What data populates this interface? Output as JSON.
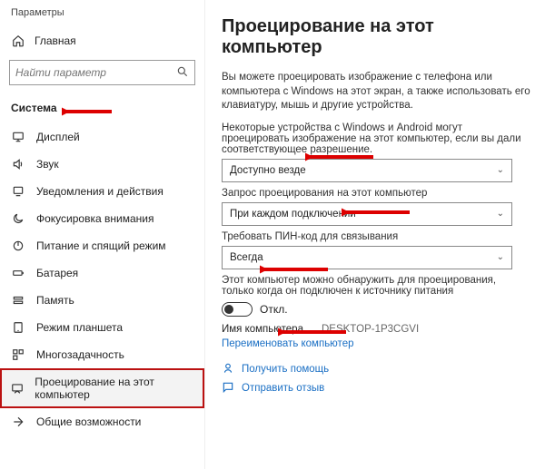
{
  "app_title": "Параметры",
  "home_label": "Главная",
  "search": {
    "placeholder": "Найти параметр"
  },
  "category": "Система",
  "sidebar": {
    "items": [
      {
        "label": "Дисплей"
      },
      {
        "label": "Звук"
      },
      {
        "label": "Уведомления и действия"
      },
      {
        "label": "Фокусировка внимания"
      },
      {
        "label": "Питание и спящий режим"
      },
      {
        "label": "Батарея"
      },
      {
        "label": "Память"
      },
      {
        "label": "Режим планшета"
      },
      {
        "label": "Многозадачность"
      },
      {
        "label": "Проецирование на этот компьютер"
      },
      {
        "label": "Общие возможности"
      }
    ]
  },
  "page": {
    "title": "Проецирование на этот компьютер",
    "intro": "Вы можете проецировать изображение с телефона или компьютера с Windows на этот экран, а также использовать его клавиатуру, мышь и другие устройства.",
    "avail_label": "Некоторые устройства с Windows и Android могут проецировать изображение на этот компьютер, если вы дали соответствующее разрешение.",
    "avail_value": "Доступно везде",
    "ask_label": "Запрос проецирования на этот компьютер",
    "ask_value": "При каждом подключении",
    "pin_label": "Требовать ПИН-код для связывания",
    "pin_value": "Всегда",
    "power_label": "Этот компьютер можно обнаружить для проецирования, только когда он подключен к источнику питания",
    "toggle_state": "Откл.",
    "pcname_label": "Имя компьютера",
    "pcname_value": "DESKTOP-1P3CGVI",
    "rename_link": "Переименовать компьютер",
    "help": "Получить помощь",
    "feedback": "Отправить отзыв"
  }
}
